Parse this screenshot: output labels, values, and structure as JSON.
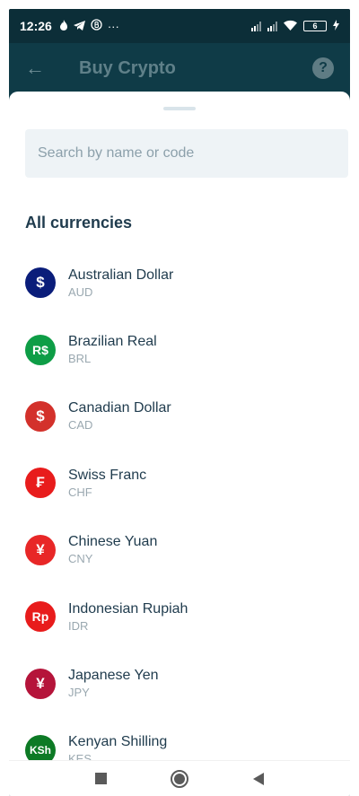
{
  "status_bar": {
    "time": "12:26",
    "left_icons": [
      "flame-icon",
      "telegram-icon",
      "b-circle-icon",
      "more-icon"
    ],
    "more_text": "···",
    "battery_level": "6"
  },
  "app_bar": {
    "back_glyph": "←",
    "title": "Buy Crypto",
    "help_glyph": "?"
  },
  "search": {
    "placeholder": "Search by name or code",
    "value": ""
  },
  "section_title": "All currencies",
  "currencies": [
    {
      "name": "Australian Dollar",
      "code": "AUD",
      "symbol": "$",
      "color": "#0a1d7a"
    },
    {
      "name": "Brazilian Real",
      "code": "BRL",
      "symbol": "R$",
      "color": "#0e9d46"
    },
    {
      "name": "Canadian Dollar",
      "code": "CAD",
      "symbol": "$",
      "color": "#d3312b"
    },
    {
      "name": "Swiss Franc",
      "code": "CHF",
      "symbol": "₣",
      "color": "#e81c1c"
    },
    {
      "name": "Chinese Yuan",
      "code": "CNY",
      "symbol": "¥",
      "color": "#e82727"
    },
    {
      "name": "Indonesian Rupiah",
      "code": "IDR",
      "symbol": "Rp",
      "color": "#e81c1c"
    },
    {
      "name": "Japanese Yen",
      "code": "JPY",
      "symbol": "¥",
      "color": "#b5143a"
    },
    {
      "name": "Kenyan Shilling",
      "code": "KES",
      "symbol": "KSh",
      "color": "#0d7a25"
    }
  ],
  "colors": {
    "app_bar_bg": "#0f3b47",
    "title_text": "#1f3b4d",
    "code_text": "#9aa8b0"
  }
}
